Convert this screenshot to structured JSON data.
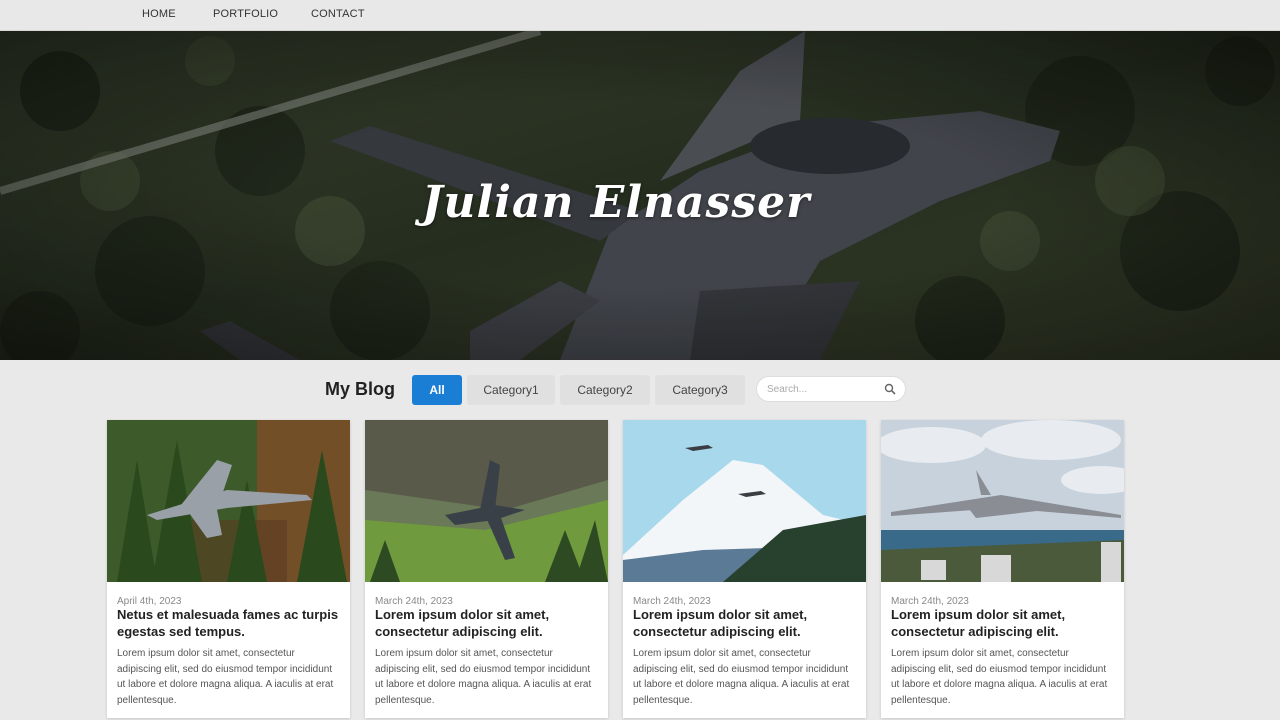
{
  "nav": {
    "home": "HOME",
    "portfolio": "PORTFOLIO",
    "contact": "CONTACT"
  },
  "hero": {
    "title": "Julian Elnasser"
  },
  "blog": {
    "heading": "My Blog",
    "tabs": [
      "All",
      "Category1",
      "Category2",
      "Category3"
    ],
    "search_placeholder": "Search..."
  },
  "posts": [
    {
      "date": "April 4th, 2023",
      "title": "Netus et malesuada fames ac turpis egestas sed tempus.",
      "excerpt": "Lorem ipsum dolor sit amet, consectetur adipiscing elit, sed do eiusmod tempor incididunt ut labore et dolore magna aliqua. A iaculis at erat pellentesque."
    },
    {
      "date": "March 24th, 2023",
      "title": "Lorem ipsum dolor sit amet, consectetur adipiscing elit.",
      "excerpt": "Lorem ipsum dolor sit amet, consectetur adipiscing elit, sed do eiusmod tempor incididunt ut labore et dolore magna aliqua. A iaculis at erat pellentesque."
    },
    {
      "date": "March 24th, 2023",
      "title": "Lorem ipsum dolor sit amet, consectetur adipiscing elit.",
      "excerpt": "Lorem ipsum dolor sit amet, consectetur adipiscing elit, sed do eiusmod tempor incididunt ut labore et dolore magna aliqua. A iaculis at erat pellentesque."
    },
    {
      "date": "March 24th, 2023",
      "title": "Lorem ipsum dolor sit amet, consectetur adipiscing elit.",
      "excerpt": "Lorem ipsum dolor sit amet, consectetur adipiscing elit, sed do eiusmod tempor incididunt ut labore et dolore magna aliqua. A iaculis at erat pellentesque."
    }
  ],
  "colors": {
    "accent": "#1a7fd4",
    "background": "#e9e9e9"
  },
  "icons": {
    "search": "search-icon"
  }
}
